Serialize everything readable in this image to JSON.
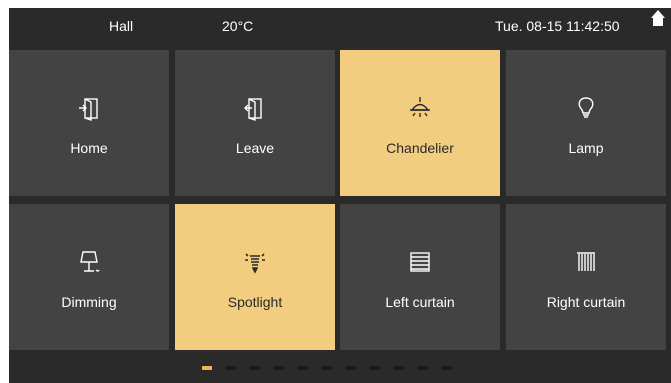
{
  "status_bar": {
    "room": "Hall",
    "temperature": "20°C",
    "datetime": "Tue. 08-15 11:42:50",
    "home_icon": "home-icon"
  },
  "tiles": [
    {
      "label": "Home",
      "icon": "door-enter-icon",
      "active": false
    },
    {
      "label": "Leave",
      "icon": "door-exit-icon",
      "active": false
    },
    {
      "label": "Chandelier",
      "icon": "chandelier-icon",
      "active": true
    },
    {
      "label": "Lamp",
      "icon": "bulb-icon",
      "active": false
    },
    {
      "label": "Dimming",
      "icon": "table-lamp-icon",
      "active": false
    },
    {
      "label": "Spotlight",
      "icon": "spotlight-icon",
      "active": true
    },
    {
      "label": "Left curtain",
      "icon": "blinds-icon",
      "active": false
    },
    {
      "label": "Right curtain",
      "icon": "curtain-icon",
      "active": false
    }
  ],
  "pager": {
    "page_count": 11,
    "current_page": 1
  },
  "colors": {
    "background": "#2a2a2a",
    "tile": "#434343",
    "tile_active": "#f2cd7f",
    "pager_active": "#f2b54f"
  }
}
